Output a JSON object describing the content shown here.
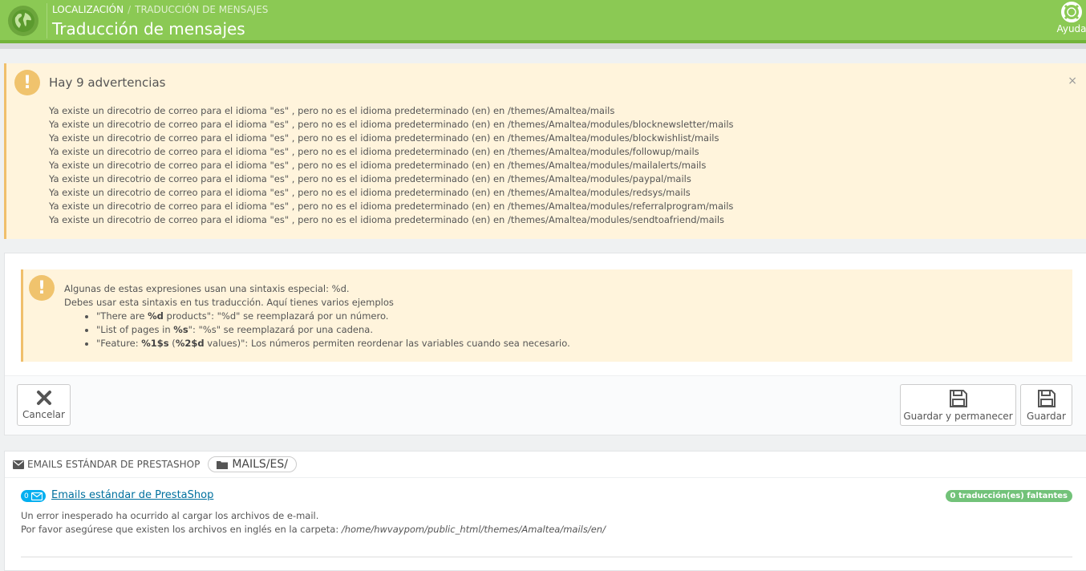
{
  "header": {
    "breadcrumb_root": "LOCALIZACIÓN",
    "breadcrumb_sep": "/",
    "breadcrumb_current": "TRADUCCIÓN DE MENSAJES",
    "title": "Traducción de mensajes",
    "help_label": "Ayuda"
  },
  "warnings": {
    "title": "Hay 9 advertencias",
    "close": "×",
    "items": [
      "Ya existe un direcotrio de correo para el idioma \"es\" , pero no es el idioma predeterminado (en) en /themes/Amaltea/mails",
      "Ya existe un direcotrio de correo para el idioma \"es\" , pero no es el idioma predeterminado (en) en /themes/Amaltea/modules/blocknewsletter/mails",
      "Ya existe un direcotrio de correo para el idioma \"es\" , pero no es el idioma predeterminado (en) en /themes/Amaltea/modules/blockwishlist/mails",
      "Ya existe un direcotrio de correo para el idioma \"es\" , pero no es el idioma predeterminado (en) en /themes/Amaltea/modules/followup/mails",
      "Ya existe un direcotrio de correo para el idioma \"es\" , pero no es el idioma predeterminado (en) en /themes/Amaltea/modules/mailalerts/mails",
      "Ya existe un direcotrio de correo para el idioma \"es\" , pero no es el idioma predeterminado (en) en /themes/Amaltea/modules/paypal/mails",
      "Ya existe un direcotrio de correo para el idioma \"es\" , pero no es el idioma predeterminado (en) en /themes/Amaltea/modules/redsys/mails",
      "Ya existe un direcotrio de correo para el idioma \"es\" , pero no es el idioma predeterminado (en) en /themes/Amaltea/modules/referralprogram/mails",
      "Ya existe un direcotrio de correo para el idioma \"es\" , pero no es el idioma predeterminado (en) en /themes/Amaltea/modules/sendtoafriend/mails"
    ]
  },
  "info": {
    "line1": "Algunas de estas expresiones usan una sintaxis especial: %d.",
    "line2": "Debes usar esta sintaxis en tus traducción. Aquí tienes varios ejemplos",
    "ex1_a": "\"There are ",
    "ex1_b": "%d",
    "ex1_c": " products\": \"%d\" se reemplazará por un número.",
    "ex2_a": "\"List of pages in ",
    "ex2_b": "%s",
    "ex2_c": "\": \"%s\" se reemplazará por una cadena.",
    "ex3_a": "\"Feature: ",
    "ex3_b": "%1$s",
    "ex3_c": " (",
    "ex3_d": "%2$d",
    "ex3_e": " values)\": Los números permiten reordenar las variables cuando sea necesario."
  },
  "buttons": {
    "cancel": "Cancelar",
    "save_stay": "Guardar y permanecer",
    "save": "Guardar"
  },
  "mails": {
    "heading": "EMAILS ESTÁNDAR DE PRESTASHOP",
    "folder": "MAILS/ES/",
    "count": "0",
    "link": "Emails estándar de PrestaShop",
    "missing": "0 traducción(es) faltantes",
    "error1": "Un error inesperado ha ocurrido al cargar los archivos de e-mail.",
    "error2": "Por favor asegúrese que existen los archivos en inglés en la carpeta: ",
    "error_path": "/home/hwvaypom/public_html/themes/Amaltea/mails/en/"
  },
  "colors": {
    "header_green": "#8bc954",
    "warning_bg": "#fff4dc",
    "warning_icon": "#f0c36d",
    "link_blue": "#00709e",
    "badge_green": "#72c279"
  }
}
